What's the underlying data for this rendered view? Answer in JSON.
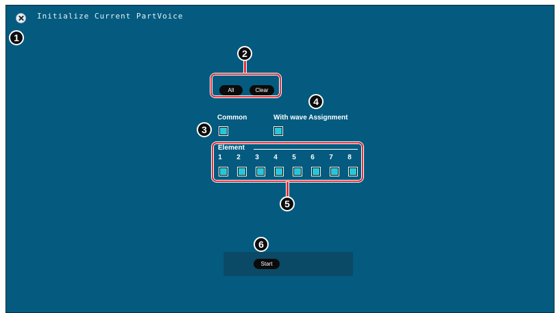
{
  "window": {
    "title": "Initialize Current PartVoice",
    "close_icon": "close-circle-icon"
  },
  "callouts": [
    "1",
    "2",
    "3",
    "4",
    "5",
    "6"
  ],
  "buttons": {
    "all": "All",
    "clear": "Clear",
    "start": "Start"
  },
  "options": {
    "common": {
      "label": "Common",
      "checked": true
    },
    "with_wave": {
      "label": "With wave Assignment",
      "checked": true
    }
  },
  "element": {
    "label": "Element",
    "numbers": [
      "1",
      "2",
      "3",
      "4",
      "5",
      "6",
      "7",
      "8"
    ]
  },
  "colors": {
    "background": "#045b7f",
    "checkbox": "#28c6d8",
    "highlight": "#e0303a"
  }
}
